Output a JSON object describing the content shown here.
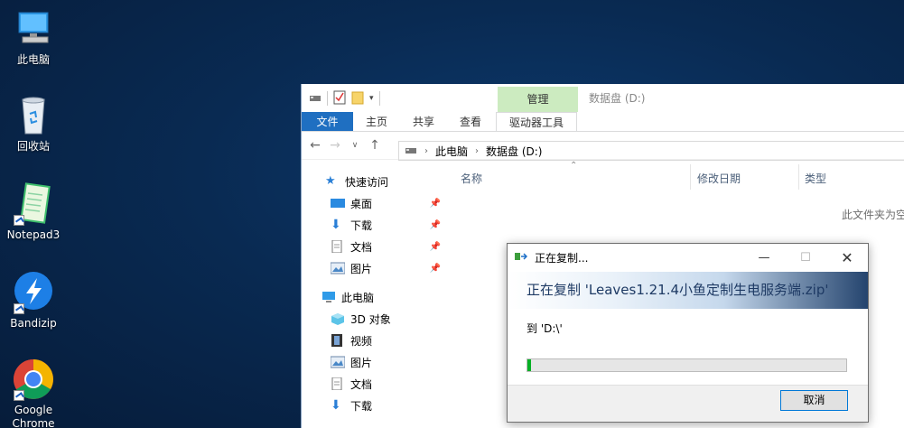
{
  "desktop": {
    "icons": [
      {
        "label": "此电脑",
        "icon": "computer-icon"
      },
      {
        "label": "回收站",
        "icon": "recycle-bin-icon"
      },
      {
        "label": "Notepad3",
        "icon": "notepad-icon"
      },
      {
        "label": "Bandizip",
        "icon": "bandizip-icon"
      },
      {
        "label": "Google Chrome",
        "icon": "chrome-icon"
      }
    ]
  },
  "explorer": {
    "title": "数据盘 (D:)",
    "context_group": "管理",
    "tabs": [
      "文件",
      "主页",
      "共享",
      "查看",
      "驱动器工具"
    ],
    "breadcrumb": [
      "此电脑",
      "数据盘 (D:)"
    ],
    "quick_access": {
      "label": "快速访问",
      "items": [
        "桌面",
        "下载",
        "文档",
        "图片"
      ]
    },
    "this_pc": {
      "label": "此电脑",
      "items": [
        "3D 对象",
        "视频",
        "图片",
        "文档",
        "下载"
      ]
    },
    "columns": [
      "名称",
      "修改日期",
      "类型"
    ],
    "empty_message": "此文件夹为空"
  },
  "copy_dialog": {
    "title": "正在复制...",
    "heading": "正在复制 'Leaves1.21.4小鱼定制生电服务端.zip'",
    "destination": "到 'D:\\'",
    "progress": 0.01,
    "cancel_label": "取消"
  },
  "colors": {
    "accent": "#1f6fc1",
    "context_tab": "#ccebc0",
    "progress": "#06b025"
  }
}
